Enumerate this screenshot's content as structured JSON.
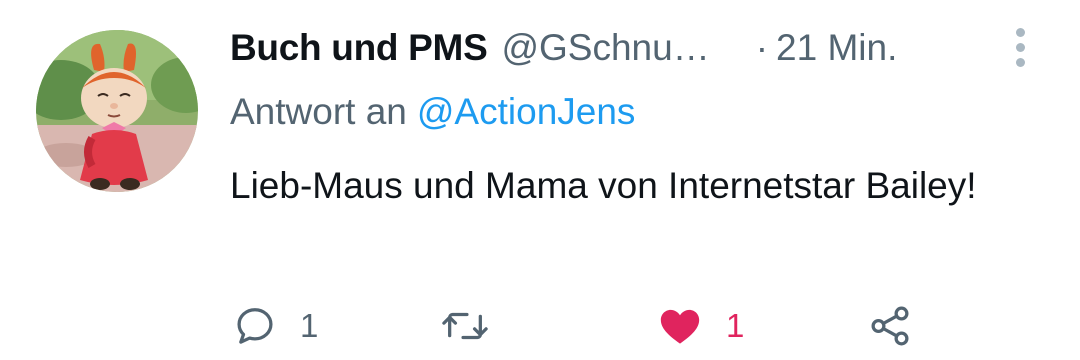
{
  "tweet": {
    "author": {
      "name": "Buch und PMS",
      "handle": "@GSchnu…",
      "avatar": "cartoon-girl-avatar"
    },
    "separator": "·",
    "time": "21 Min.",
    "reply_to": {
      "prefix": "Antwort an",
      "mention": "@ActionJens"
    },
    "text": "Lieb-Maus und Mama von Internetstar Bailey!",
    "actions": {
      "reply": {
        "icon": "reply-icon",
        "count": "1"
      },
      "retweet": {
        "icon": "retweet-icon",
        "count": ""
      },
      "like": {
        "icon": "heart-filled-icon",
        "count": "1",
        "liked": true
      },
      "share": {
        "icon": "share-icon"
      }
    },
    "menu_icon": "more-vertical-icon"
  },
  "colors": {
    "text_primary": "#0f1419",
    "text_secondary": "#536471",
    "link": "#1d9bf0",
    "like_active": "#e0245e",
    "icon_gray": "#536471"
  }
}
